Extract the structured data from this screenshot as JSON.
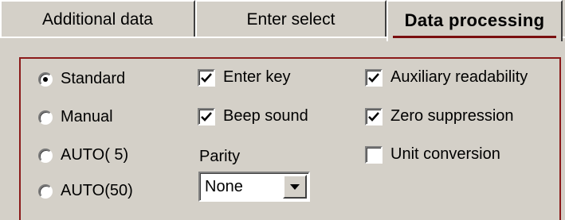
{
  "tabs": [
    {
      "label": "Additional data",
      "active": false
    },
    {
      "label": "Enter select",
      "active": false
    },
    {
      "label": "Data processing",
      "active": true
    }
  ],
  "mode_radios": [
    {
      "label": "Standard",
      "checked": true
    },
    {
      "label": "Manual",
      "checked": false
    },
    {
      "label": "AUTO( 5)",
      "checked": false
    },
    {
      "label": "AUTO(50)",
      "checked": false
    }
  ],
  "checkboxes_middle": [
    {
      "label": "Enter key",
      "checked": true
    },
    {
      "label": "Beep sound",
      "checked": true
    }
  ],
  "checkboxes_right": [
    {
      "label": "Auxiliary readability",
      "checked": true
    },
    {
      "label": "Zero suppression",
      "checked": true
    },
    {
      "label": "Unit conversion",
      "checked": false
    }
  ],
  "parity": {
    "label": "Parity",
    "value": "None"
  },
  "colors": {
    "frame": "#8b1a1a",
    "active_tab_underline": "#7a0f0f",
    "dialog_bg": "#d4d0c8"
  }
}
